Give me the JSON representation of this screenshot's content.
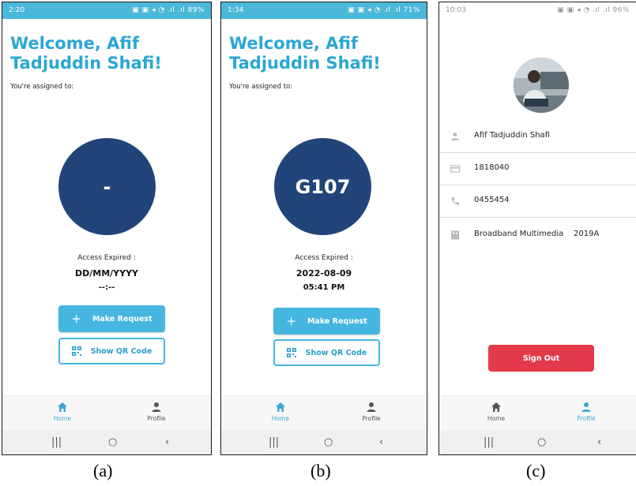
{
  "screens": [
    {
      "status_time": "2:20",
      "status_icons": "▣ ▣ ◂ ◔ .ıl .ıl 89%",
      "welcome": "Welcome, Afif Tadjuddin Shafi!",
      "assigned": "You're assigned to:",
      "room": "-",
      "expire_label": "Access Expired :",
      "expire_date": "DD/MM/YYYY",
      "expire_time": "--:--",
      "make_request": "Make Request",
      "show_qr": "Show QR Code",
      "nav_home": "Home",
      "nav_profile": "Profile",
      "caption": "(a)"
    },
    {
      "status_time": "1:34",
      "status_icons": "▣ ▣ ◂ ◔ .ıl .ıl 71%",
      "welcome": "Welcome, Afif Tadjuddin Shafi!",
      "assigned": "You're assigned to:",
      "room": "G107",
      "expire_label": "Access Expired :",
      "expire_date": "2022-08-09",
      "expire_time": "05:41 PM",
      "make_request": "Make Request",
      "show_qr": "Show QR Code",
      "nav_home": "Home",
      "nav_profile": "Profile",
      "caption": "(b)"
    }
  ],
  "profile": {
    "status_time": "10:03",
    "status_icons": "▣ ▣ ◂ ◔ .ıl .ıl 96%",
    "name": "Afif Tadjuddin Shafi",
    "id_number": "1818040",
    "phone": "0455454",
    "department": "Broadband Multimedia    2019A",
    "sign_out": "Sign Out",
    "nav_home": "Home",
    "nav_profile": "Profile",
    "caption": "(c)"
  },
  "system_nav": {
    "recents": "|||",
    "home": "○",
    "back": "‹"
  },
  "colors": {
    "accent": "#45b6e0",
    "title": "#2ba6d3",
    "circle": "#21447a",
    "signout": "#e23a4a",
    "statusbar": "#4ab8d9"
  }
}
